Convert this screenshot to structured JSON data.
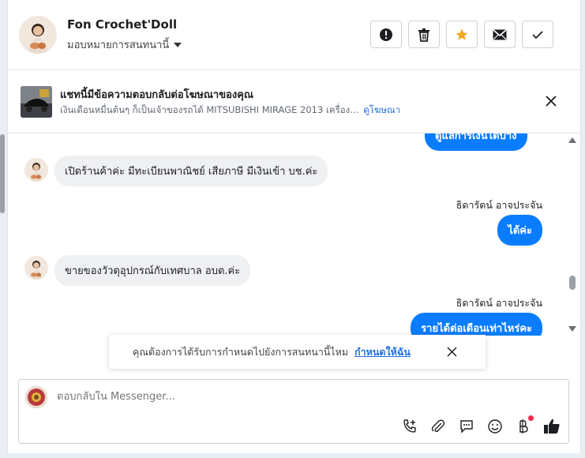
{
  "header": {
    "name": "Fon Crochet'Doll",
    "assign_label": "มอบหมายการสนทนานี้"
  },
  "ad_banner": {
    "title": "แชทนี้มีข้อความตอบกลับต่อโฆษณาของคุณ",
    "subtitle": "เงินเดือนหมื่นต้นๆ ก็เป็นเจ้าของรถได้ MITSUBISHI MIRAGE 2013 เครื่อง...",
    "link": "ดูโฆษณา"
  },
  "messages": {
    "top_partial": "ดูแลการเงินได้บ้าง",
    "incoming_1": "เปิดร้านค้าค่ะ มีทะเบียนพาณิชย์ เสียภาษี มีเงินเข้า บช.ค่ะ",
    "sender_1": "ธิดารัตน์ อาจประจัน",
    "outgoing_1": "ได้ค่ะ",
    "incoming_2": "ขายของวัวดุอุปกรณ์กับเทศบาล อบต.ค่ะ",
    "sender_2": "ธิดารัตน์ อาจประจัน",
    "outgoing_2": "รายได้ต่อเดือนเท่าไหร่คะ"
  },
  "schedule_prompt": {
    "text": "คุณต้องการได้รับการกำหนดไปยังการสนทนานี้ไหม",
    "link": "กำหนดให้ฉัน"
  },
  "composer": {
    "placeholder": "ตอบกลับใน Messenger..."
  },
  "colors": {
    "accent": "#0a7cff",
    "link": "#216fdb",
    "star": "#f5a623",
    "notify": "#f02849"
  }
}
